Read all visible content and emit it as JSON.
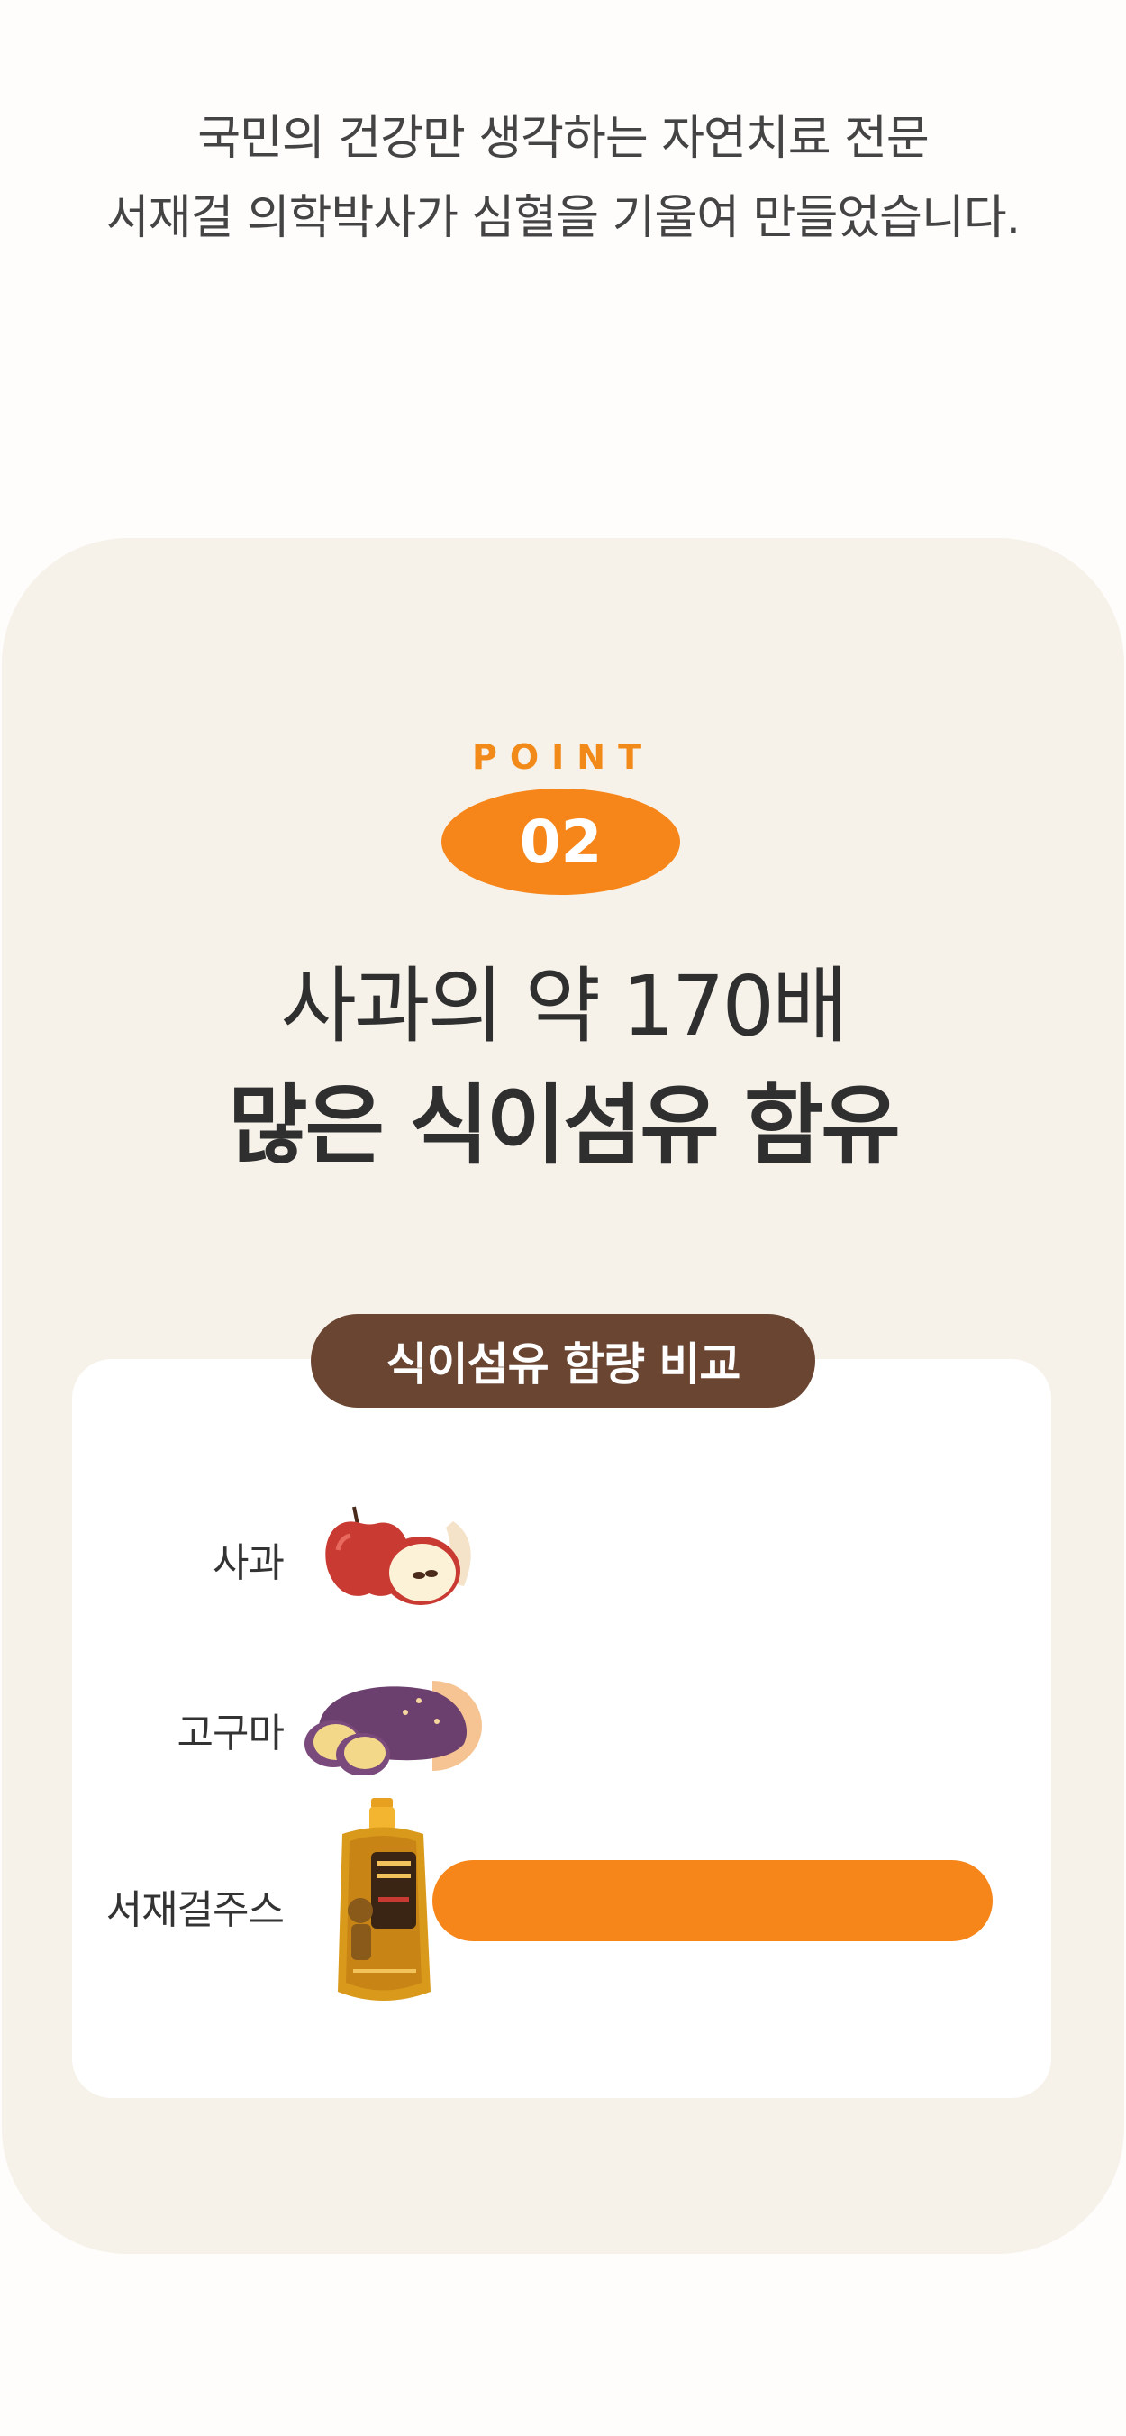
{
  "intro": {
    "line1": "국민의 건강만 생각하는 자연치료 전문",
    "line2": "서재걸 의학박사가 심혈을 기울여 만들었습니다."
  },
  "point": {
    "label": "POINT",
    "number": "02"
  },
  "headline": {
    "line1": "사과의 약 170배",
    "line2": "많은 식이섬유 함유"
  },
  "chart_data": {
    "type": "bar",
    "title": "식이섬유 함량 비교",
    "categories": [
      "사과",
      "고구마",
      "서재걸주스"
    ],
    "values": [
      1,
      2.5,
      170
    ],
    "xlabel": "",
    "ylabel": "",
    "grid": false,
    "colors": {
      "bar": "#f7861a",
      "badge": "#6a4532"
    },
    "icons": [
      "apple-icon",
      "sweet-potato-icon",
      "juice-pouch-icon"
    ]
  }
}
